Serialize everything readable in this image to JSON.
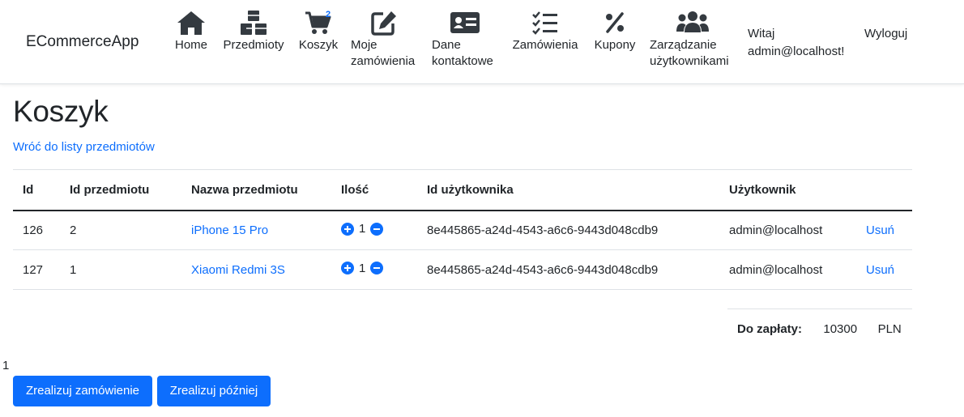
{
  "navbar": {
    "brand": "ECommerceApp",
    "items": [
      {
        "label": "Home",
        "icon": "home-icon"
      },
      {
        "label": "Przedmioty",
        "icon": "cubes-icon"
      },
      {
        "label": "Koszyk",
        "icon": "cart-icon",
        "badge": "2"
      },
      {
        "label_line1": "Moje",
        "label_line2": "zamówienia",
        "icon": "edit-icon"
      },
      {
        "label_line1": "Dane",
        "label_line2": "kontaktowe",
        "icon": "contact-card-icon"
      },
      {
        "label": "Zamówienia",
        "icon": "task-list-icon"
      },
      {
        "label": "Kupony",
        "icon": "percent-icon"
      },
      {
        "label_line1": "Zarządzanie",
        "label_line2": "użytkownikami",
        "icon": "users-icon"
      }
    ],
    "greeting_line1": "Witaj",
    "greeting_line2": "admin@localhost!",
    "logout": "Wyloguj"
  },
  "page": {
    "title": "Koszyk",
    "back_link": "Wróć do listy przedmiotów"
  },
  "table": {
    "headers": {
      "id": "Id",
      "item_id": "Id przedmiotu",
      "item_name": "Nazwa przedmiotu",
      "quantity": "Ilość",
      "user_id": "Id użytkownika",
      "user": "Użytkownik"
    },
    "rows": [
      {
        "id": "126",
        "item_id": "2",
        "item_name": "iPhone 15 Pro",
        "quantity": "1",
        "user_id": "8e445865-a24d-4543-a6c6-9443d048cdb9",
        "user": "admin@localhost",
        "action": "Usuń"
      },
      {
        "id": "127",
        "item_id": "1",
        "item_name": "Xiaomi Redmi 3S",
        "quantity": "1",
        "user_id": "8e445865-a24d-4543-a6c6-9443d048cdb9",
        "user": "admin@localhost",
        "action": "Usuń"
      }
    ]
  },
  "summary": {
    "label": "Do zapłaty:",
    "amount": "10300",
    "currency": "PLN"
  },
  "stray_text": "1",
  "buttons": {
    "order_now": "Zrealizuj zamówienie",
    "order_later": "Zrealizuj później"
  },
  "colors": {
    "primary": "#0d6efd",
    "text": "#212529",
    "border": "#dee2e6"
  }
}
